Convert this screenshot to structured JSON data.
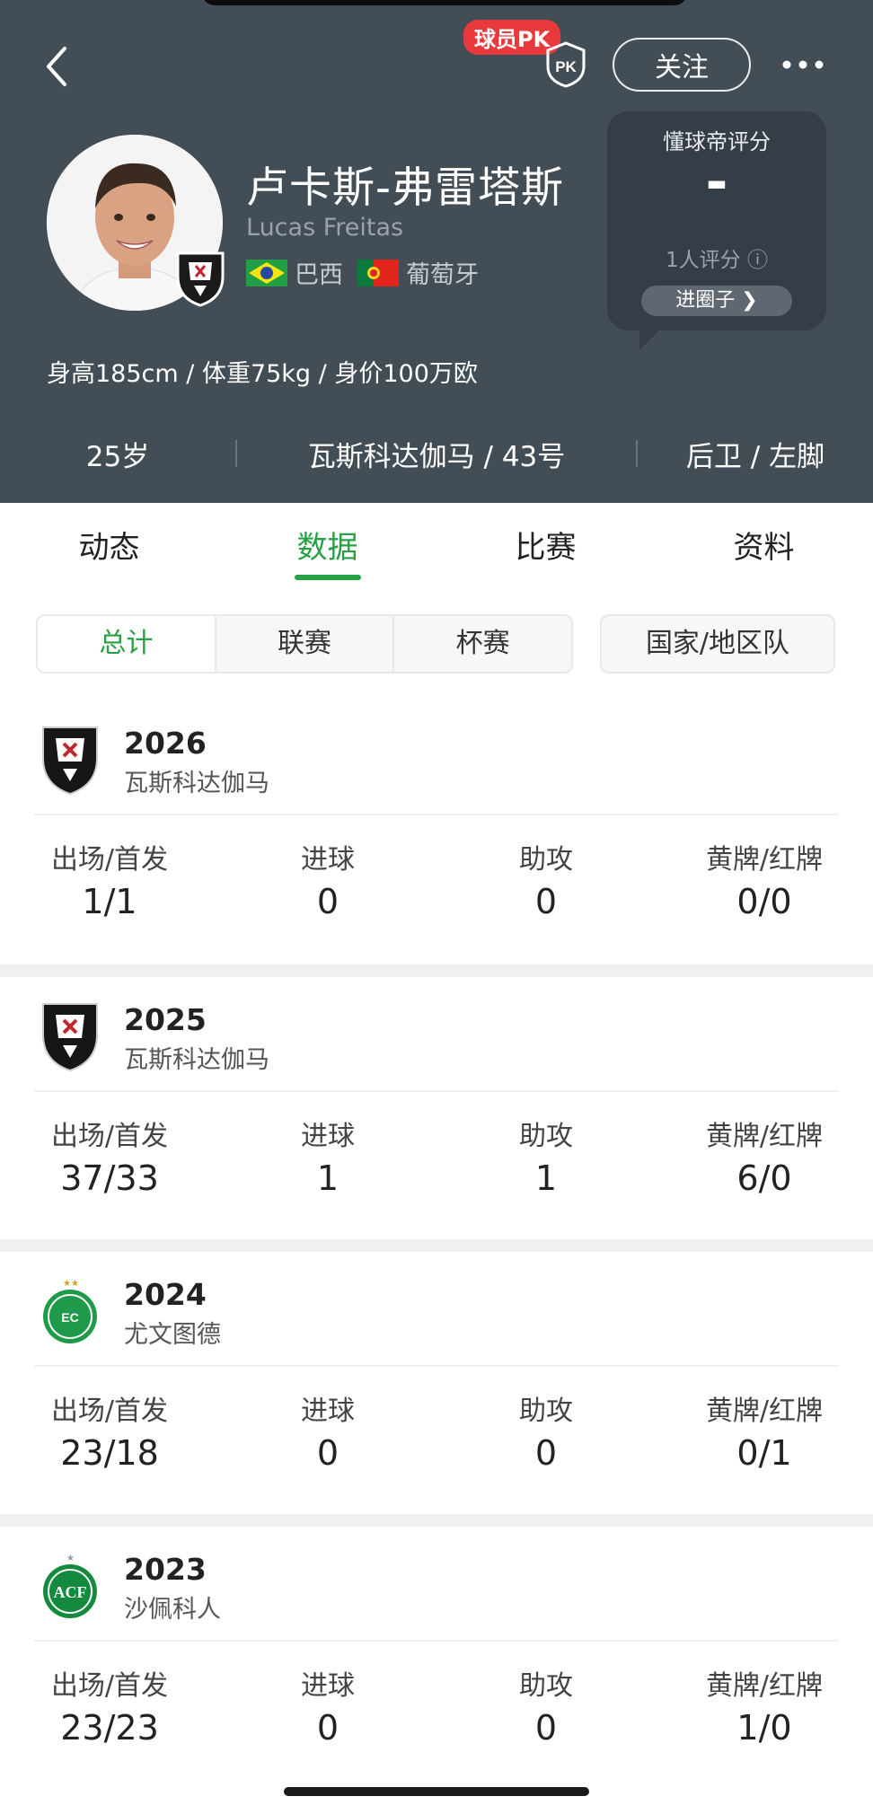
{
  "header": {
    "pk_label": "球员PK",
    "pk_icon_text": "PK",
    "follow_label": "关注",
    "player_name": "卢卡斯-弗雷塔斯",
    "player_name_en": "Lucas Freitas",
    "nationalities": [
      {
        "flag": "brazil-flag-icon",
        "name": "巴西"
      },
      {
        "flag": "portugal-flag-icon",
        "name": "葡萄牙"
      }
    ],
    "rating": {
      "title": "懂球帝评分",
      "value": "-",
      "count": "1人评分 ⓘ",
      "enter": "进圈子 ❯"
    },
    "measurements": "身高185cm / 体重75kg / 身价100万欧",
    "age": "25岁",
    "team_number": "瓦斯科达伽马 / 43号",
    "position_foot": "后卫 / 左脚"
  },
  "tabs": [
    "动态",
    "数据",
    "比赛",
    "资料"
  ],
  "active_tab": "数据",
  "filters": {
    "segments": [
      "总计",
      "联赛",
      "杯赛"
    ],
    "national": "国家/地区队"
  },
  "stat_labels": [
    "出场/首发",
    "进球",
    "助攻",
    "黄牌/红牌"
  ],
  "seasons": [
    {
      "year": "2026",
      "club": "瓦斯科达伽马",
      "logo": "vasco-da-gama-crest-icon",
      "apps": "1/1",
      "goals": "0",
      "assists": "0",
      "cards": "0/0"
    },
    {
      "year": "2025",
      "club": "瓦斯科达伽马",
      "logo": "vasco-da-gama-crest-icon",
      "apps": "37/33",
      "goals": "1",
      "assists": "1",
      "cards": "6/0"
    },
    {
      "year": "2024",
      "club": "尤文图德",
      "logo": "juventude-crest-icon",
      "apps": "23/18",
      "goals": "0",
      "assists": "0",
      "cards": "0/1"
    },
    {
      "year": "2023",
      "club": "沙佩科人",
      "logo": "chapecoense-crest-icon",
      "apps": "23/23",
      "goals": "0",
      "assists": "0",
      "cards": "1/0"
    }
  ],
  "colors": {
    "header_bg": "#434d56",
    "accent_green": "#27a046",
    "pk_red": "#e8393d"
  }
}
